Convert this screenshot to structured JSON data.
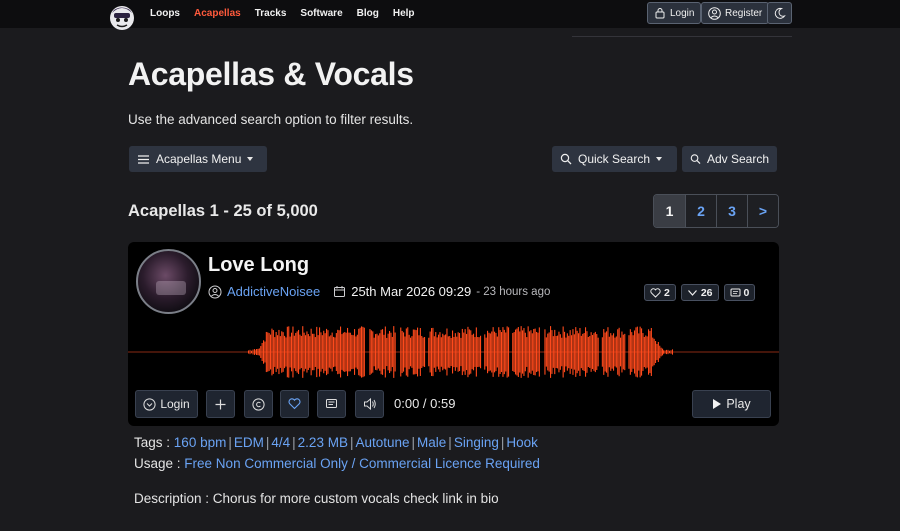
{
  "nav": {
    "links": [
      {
        "label": "Loops",
        "active": false
      },
      {
        "label": "Acapellas",
        "active": true
      },
      {
        "label": "Tracks",
        "active": false
      },
      {
        "label": "Software",
        "active": false
      },
      {
        "label": "Blog",
        "active": false
      },
      {
        "label": "Help",
        "active": false
      }
    ],
    "login_label": "Login",
    "register_label": "Register",
    "accent_color": "#ff5a3c"
  },
  "page": {
    "title": "Acapellas & Vocals",
    "subtitle": "Use the advanced search option to filter results.",
    "menu_label": "Acapellas Menu",
    "quick_search_label": "Quick Search",
    "adv_search_label": "Adv Search",
    "result_count": "Acapellas 1 - 25 of 5,000",
    "pagination": [
      "1",
      "2",
      "3",
      ">"
    ],
    "current_page": "1"
  },
  "track": {
    "title": "Love Long",
    "artist": "AddictiveNoisee",
    "date": "25th Mar 2026 09:29",
    "ago": "- 23 hours ago",
    "likes": "2",
    "downloads": "26",
    "comments": "0",
    "login_label": "Login",
    "time": "0:00 / 0:59",
    "play_label": "Play",
    "waveform_color": "#ff4a1c",
    "tags_label": "Tags :",
    "tags": [
      "160 bpm",
      "EDM",
      "4/4",
      "2.23 MB",
      "Autotune",
      "Male",
      "Singing",
      "Hook"
    ],
    "usage_label": "Usage :",
    "usage": "Free Non Commercial Only / Commercial Licence Required",
    "description_label": "Description :",
    "description": "Chorus for more custom vocals check link in bio"
  },
  "icons": [
    "site-logo-icon",
    "lock-icon",
    "user-icon",
    "moon-icon",
    "menu-icon",
    "search-icon",
    "heart-icon",
    "download-icon",
    "comment-icon",
    "user-circle-icon",
    "calendar-icon",
    "plus-icon",
    "copyright-icon",
    "volume-icon",
    "play-icon"
  ]
}
